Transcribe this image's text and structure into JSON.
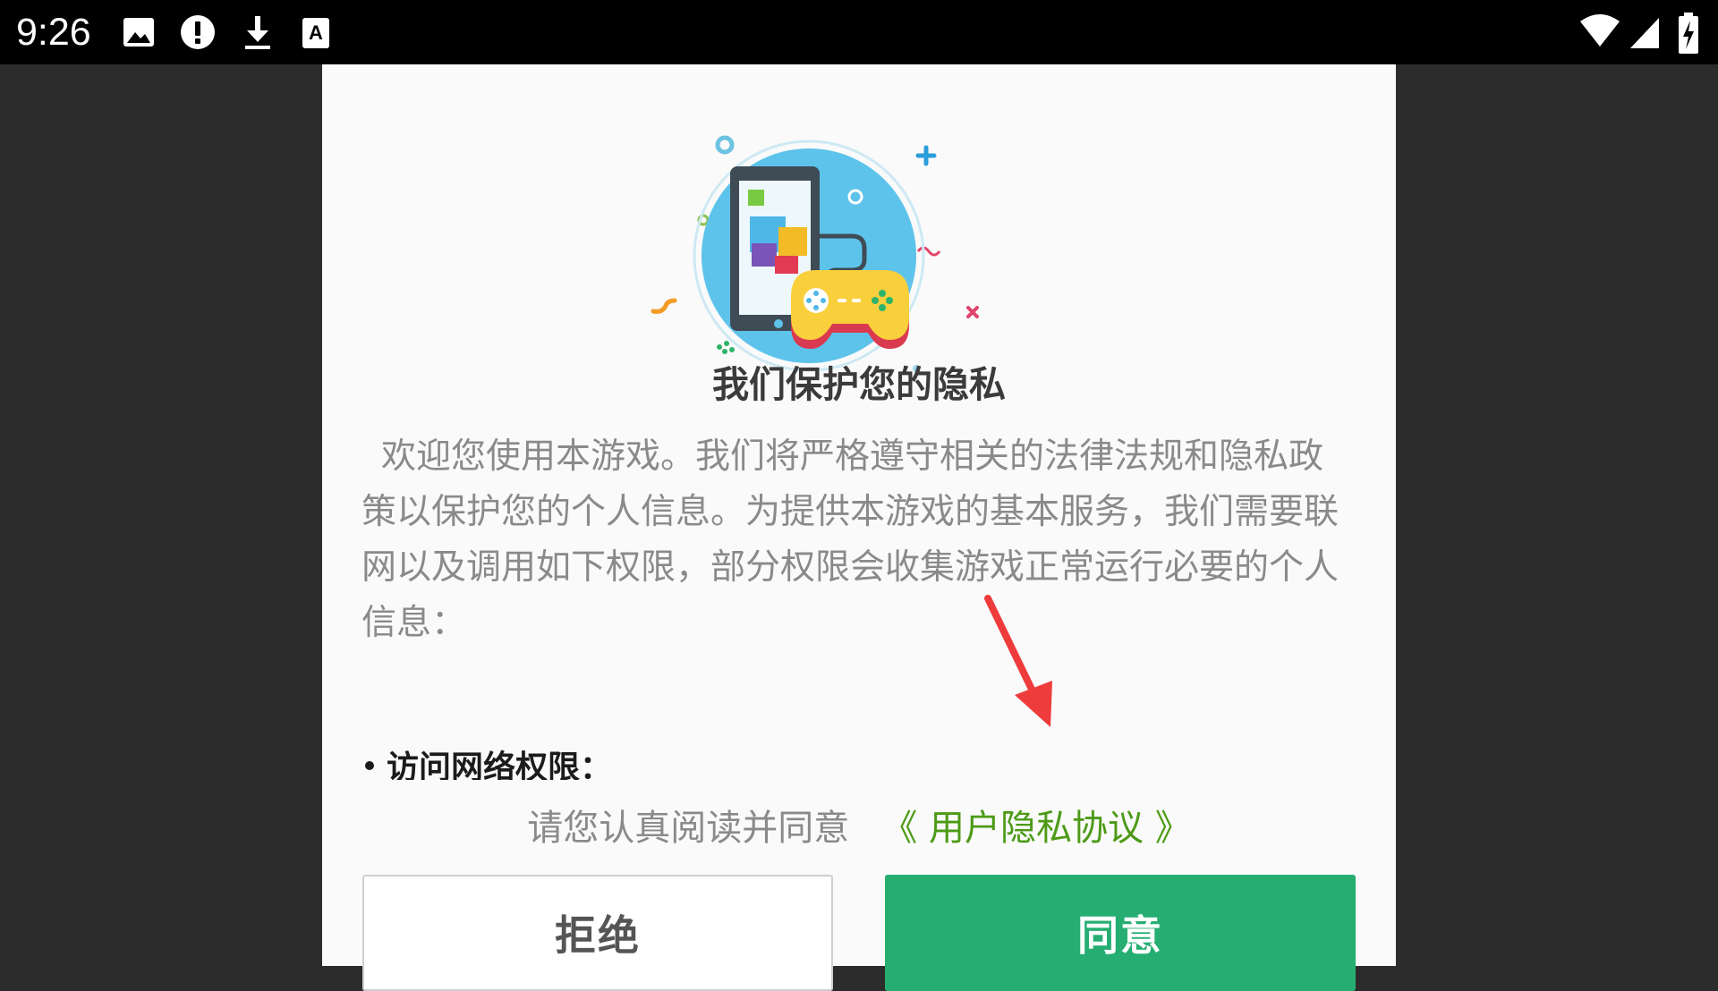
{
  "status_bar": {
    "time": "9:26",
    "left_icons": [
      "image-notification-icon",
      "alert-notification-icon",
      "download-notification-icon",
      "text-notification-icon"
    ],
    "right_icons": [
      "wifi-icon",
      "cell-signal-icon",
      "battery-charging-icon"
    ]
  },
  "dialog": {
    "illustration": "phone-and-gamepad-illustration",
    "title": "我们保护您的隐私",
    "body": "欢迎您使用本游戏。我们将严格遵守相关的法律法规和隐私政策以保护您的个人信息。为提供本游戏的基本服务，我们需要联网以及调用如下权限，部分权限会收集游戏正常运行必要的个人信息：",
    "bullet": "访问网络权限：",
    "agree_prompt": "请您认真阅读并同意",
    "policy_link": "《 用户隐私协议 》",
    "reject_label": "拒绝",
    "agree_label": "同意"
  },
  "colors": {
    "page_bg": "#2c2c2c",
    "dialog_bg": "#fafafa",
    "accent_green": "#26ae72",
    "link_green": "#4c9a16",
    "annotation_arrow": "#ee3b3b"
  }
}
